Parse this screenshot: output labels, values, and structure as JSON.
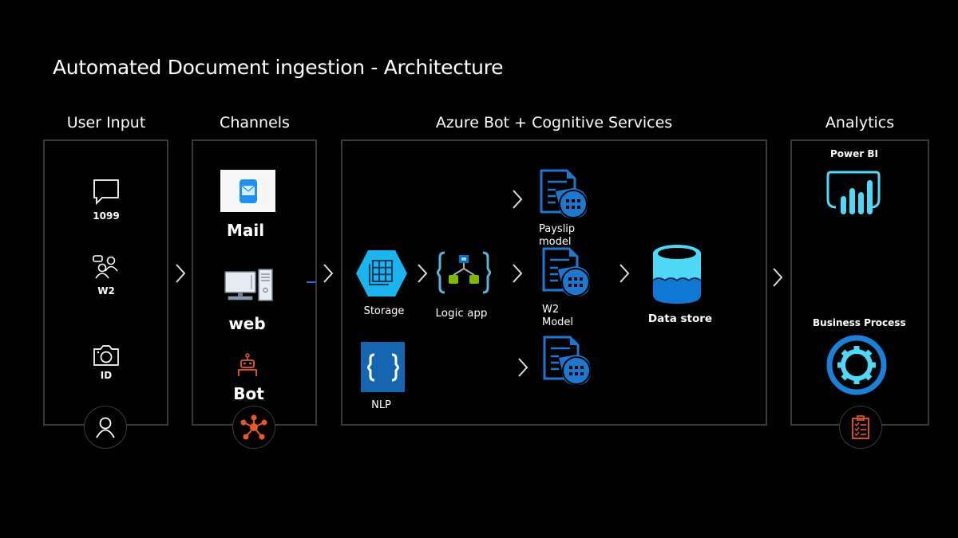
{
  "title": "Automated Document ingestion - Architecture",
  "sections": {
    "user_input": {
      "heading": "User Input",
      "items": [
        {
          "icon": "chat-bubble-icon",
          "label": "1099"
        },
        {
          "icon": "people-chat-icon",
          "label": "W2"
        },
        {
          "icon": "camera-icon",
          "label": "ID"
        }
      ],
      "badge_icon": "user-icon"
    },
    "channels": {
      "heading": "Channels",
      "items": [
        {
          "icon": "mail-icon",
          "label": "Mail"
        },
        {
          "icon": "desktop-computer-icon",
          "label": "web"
        },
        {
          "icon": "robot-icon",
          "label": "Bot"
        }
      ],
      "badge_icon": "hub-network-icon"
    },
    "azure": {
      "heading": "Azure Bot + Cognitive Services",
      "storage_label": "Storage",
      "logic_app_label": "Logic app",
      "nlp_label": "NLP",
      "models": [
        {
          "label_line1": "Payslip",
          "label_line2": "model"
        },
        {
          "label_line1": "W2",
          "label_line2": "Model"
        },
        {
          "label_line1": "",
          "label_line2": ""
        }
      ],
      "data_store_label": "Data store"
    },
    "analytics": {
      "heading": "Analytics",
      "power_bi_label": "Power BI",
      "business_process_label": "Business Process",
      "badge_icon": "clipboard-checklist-icon"
    }
  },
  "colors": {
    "azure_blue": "#0078d4",
    "cyan": "#50e6ff",
    "orange": "#e8582a",
    "logic_green": "#7fba00",
    "panel_border": "#3a3a3a"
  }
}
